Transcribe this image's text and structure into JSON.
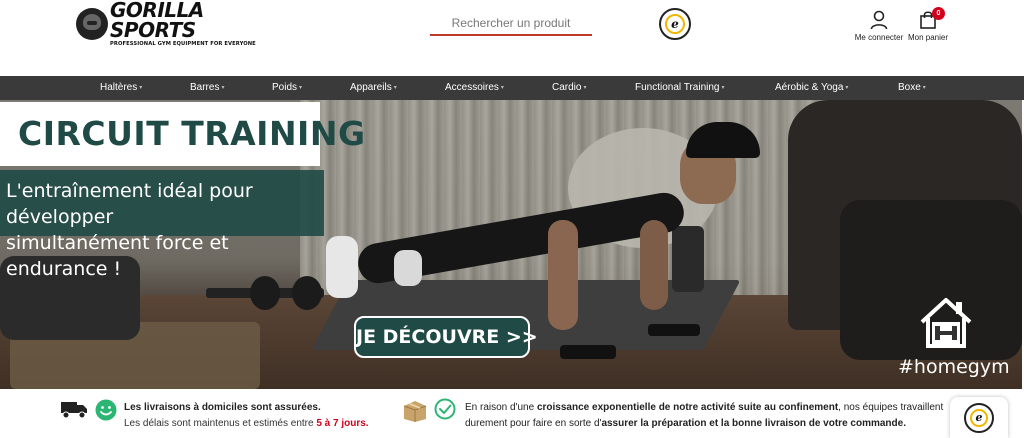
{
  "header": {
    "logo_name": "GORILLA SPORTS",
    "logo_tagline": "PROFESSIONAL GYM EQUIPMENT FOR EVERYONE",
    "search_placeholder": "Rechercher un produit",
    "trusted_mark": "e",
    "account_label": "Me connecter",
    "cart_label": "Mon panier",
    "cart_count": "0"
  },
  "nav": {
    "items": [
      {
        "label": "Haltères"
      },
      {
        "label": "Barres"
      },
      {
        "label": "Poids"
      },
      {
        "label": "Appareils"
      },
      {
        "label": "Accessoires"
      },
      {
        "label": "Cardio"
      },
      {
        "label": "Functional Training"
      },
      {
        "label": "Aérobic & Yoga"
      },
      {
        "label": "Boxe"
      }
    ],
    "arrow": "▾"
  },
  "hero": {
    "title": "CIRCUIT TRAINING",
    "subtitle_line1": "L'entraînement idéal pour développer",
    "subtitle_line2": "simultanément force et endurance !",
    "cta": "JE DÉCOUVRE >>",
    "hashtag": "#homegym"
  },
  "info": {
    "left_line1": "Les livraisons à domiciles sont assurées.",
    "left_line2_a": "Les délais sont maintenus et estimés entre ",
    "left_line2_b": "5 à 7 jours.",
    "right_line1_a": "En raison d'une ",
    "right_line1_b": "croissance exponentielle de notre activité suite au confinement",
    "right_line1_c": ", nos équipes travaillent",
    "right_line2_a": "durement pour faire en sorte d'",
    "right_line2_b": "assurer la préparation et la bonne livraison de votre commande.",
    "trusted_mark": "e"
  },
  "colors": {
    "brand_green": "#1f4a46",
    "nav_bg": "#3a3a3a",
    "accent_red": "#d0021b",
    "smile_green": "#2bb673"
  }
}
